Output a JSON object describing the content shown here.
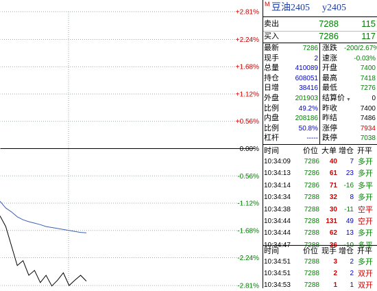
{
  "instrument": {
    "marker": "M",
    "name": "豆油2405",
    "code": "y2405"
  },
  "quote": {
    "ask": {
      "label": "卖出",
      "price": "7288",
      "volume": "115"
    },
    "bid": {
      "label": "买入",
      "price": "7286",
      "volume": "117"
    }
  },
  "stats_left": [
    {
      "label": "最新",
      "value": "7286"
    },
    {
      "label": "现手",
      "value": "2"
    },
    {
      "label": "总量",
      "value": "410089"
    },
    {
      "label": "持仓",
      "value": "608051"
    },
    {
      "label": "日增",
      "value": "38416"
    },
    {
      "label": "外盘",
      "value": "201903"
    },
    {
      "label": "比例",
      "value": "49.2%"
    },
    {
      "label": "内盘",
      "value": "208186"
    },
    {
      "label": "比例",
      "value": "50.8%"
    },
    {
      "label": "杠杆",
      "value": "-----"
    }
  ],
  "stats_right": [
    {
      "label": "涨跌",
      "value": "-200/2.67%"
    },
    {
      "label": "速涨",
      "value": "-0.03%"
    },
    {
      "label": "开盘",
      "value": "7400"
    },
    {
      "label": "最高",
      "value": "7418"
    },
    {
      "label": "最低",
      "value": "7276"
    },
    {
      "label": "结算价",
      "value": "0"
    },
    {
      "label": "昨收",
      "value": "7400"
    },
    {
      "label": "昨结",
      "value": "7486"
    },
    {
      "label": "涨停",
      "value": "7934"
    },
    {
      "label": "跌停",
      "value": "7038"
    }
  ],
  "trades_header": {
    "time": "时间",
    "price": "价位",
    "volume": "大单",
    "oi": "增仓",
    "type": "开平"
  },
  "trades": [
    {
      "time": "10:34:09",
      "price": "7286",
      "volume": "40",
      "oi": "7",
      "type": "多开"
    },
    {
      "time": "10:34:13",
      "price": "7286",
      "volume": "61",
      "oi": "23",
      "type": "多开"
    },
    {
      "time": "10:34:14",
      "price": "7286",
      "volume": "71",
      "oi": "-16",
      "type": "多平"
    },
    {
      "time": "10:34:34",
      "price": "7288",
      "volume": "32",
      "oi": "8",
      "type": "多开"
    },
    {
      "time": "10:34:38",
      "price": "7288",
      "volume": "30",
      "oi": "-11",
      "type": "空平"
    },
    {
      "time": "10:34:44",
      "price": "7288",
      "volume": "131",
      "oi": "49",
      "type": "空开"
    },
    {
      "time": "10:34:44",
      "price": "7288",
      "volume": "62",
      "oi": "13",
      "type": "多开"
    },
    {
      "time": "10:34:47",
      "price": "7288",
      "volume": "36",
      "oi": "-10",
      "type": "多平"
    }
  ],
  "ticks_header": {
    "time": "时间",
    "price": "价位",
    "volume": "现手",
    "oi": "增仓",
    "type": "开平"
  },
  "ticks": [
    {
      "time": "10:34:51",
      "price": "7288",
      "volume": "3",
      "oi": "2",
      "type": "多开"
    },
    {
      "time": "10:34:51",
      "price": "7288",
      "volume": "2",
      "oi": "2",
      "type": "双开"
    },
    {
      "time": "10:34:53",
      "price": "7288",
      "volume": "1",
      "oi": "1",
      "type": "双开"
    }
  ],
  "chart_data": {
    "type": "line",
    "y_axis_labels": [
      "+2.81%",
      "+2.24%",
      "+1.68%",
      "+1.12%",
      "+0.56%",
      "0.00%",
      "-0.56%",
      "-1.12%",
      "-1.68%",
      "-2.24%",
      "-2.81%"
    ],
    "ylim": [
      -2.81,
      2.81
    ],
    "series": [
      {
        "values_pct": [
          -1.08,
          -1.22,
          -1.3,
          -1.4,
          -1.46,
          -1.5,
          -1.53,
          -1.56,
          -1.6,
          -1.62,
          -1.64,
          -1.66,
          -1.68,
          -1.7,
          -1.72,
          -1.73
        ],
        "color": "#3d5fb0"
      },
      {
        "values_pct": [
          -1.38,
          -1.6,
          -2.0,
          -2.4,
          -2.3,
          -2.6,
          -2.5,
          -2.75,
          -2.6,
          -2.82,
          -2.7,
          -2.55,
          -2.81,
          -2.7,
          -2.6,
          -2.72
        ],
        "color": "#000000"
      }
    ],
    "colors": {
      "up": "#d00000",
      "down": "#008000",
      "zero": "#000000"
    }
  },
  "colors": {
    "up": "#d00000",
    "down": "#008000",
    "neutral": "#000000",
    "accent": "#0000c8",
    "title": "#1f3d9c"
  }
}
